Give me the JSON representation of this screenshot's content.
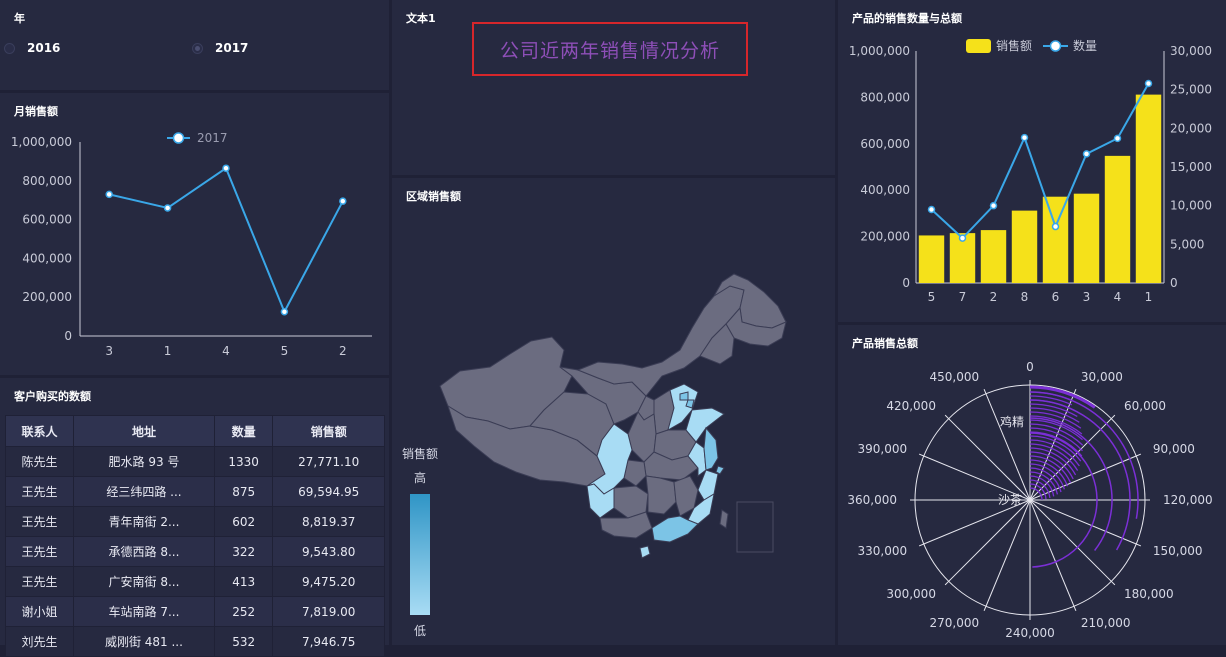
{
  "year_panel": {
    "title": "年",
    "options": [
      "2016",
      "2017"
    ],
    "selected": "2017"
  },
  "monthly_panel": {
    "title": "月销售额"
  },
  "customers_panel": {
    "title": "客户购买的数额",
    "columns": [
      "联系人",
      "地址",
      "数量",
      "销售额"
    ],
    "rows": [
      [
        "陈先生",
        "肥水路 93 号",
        "1330",
        "27,771.10"
      ],
      [
        "王先生",
        "经三纬四路 ...",
        "875",
        "69,594.95"
      ],
      [
        "王先生",
        "青年南街 2...",
        "602",
        "8,819.37"
      ],
      [
        "王先生",
        "承德西路 8...",
        "322",
        "9,543.80"
      ],
      [
        "王先生",
        "广安南街 8...",
        "413",
        "9,475.20"
      ],
      [
        "谢小姐",
        "车站南路 7...",
        "252",
        "7,819.00"
      ],
      [
        "刘先生",
        "威刚街 481 ...",
        "532",
        "7,946.75"
      ]
    ]
  },
  "text_panel": {
    "title": "文本1",
    "headline": "公司近两年销售情况分析"
  },
  "map_panel": {
    "title": "区域销售额",
    "legend_title": "销售额",
    "legend_high": "高",
    "legend_low": "低",
    "colors": {
      "high": "#2f95c6",
      "low": "#a8dcf4",
      "none": "#6b6c80"
    }
  },
  "combo_panel": {
    "title": "产品的销售数量与总额"
  },
  "polar_panel": {
    "title": "产品销售总额"
  },
  "chart_data": [
    {
      "type": "line",
      "categories": [
        "3",
        "1",
        "4",
        "5",
        "2"
      ],
      "series": [
        {
          "name": "2017",
          "values": [
            730000,
            660000,
            865000,
            125000,
            695000
          ]
        }
      ],
      "ylim": [
        0,
        1000000
      ],
      "yticks": [
        "0",
        "200,000",
        "400,000",
        "600,000",
        "800,000",
        "1,000,000"
      ],
      "legend": "top-center",
      "colors": {
        "line": "#3aa7e8"
      }
    },
    {
      "type": "bar",
      "categories": [
        "5",
        "7",
        "2",
        "8",
        "6",
        "3",
        "4",
        "1"
      ],
      "series": [
        {
          "name": "销售额",
          "type": "bar",
          "axis": "left",
          "values": [
            205000,
            215000,
            228000,
            312000,
            372000,
            385000,
            548000,
            812000
          ]
        },
        {
          "name": "数量",
          "type": "line",
          "axis": "right",
          "values": [
            9500,
            5800,
            10000,
            18800,
            7300,
            16700,
            18700,
            25800
          ]
        }
      ],
      "ylim_left": [
        0,
        1000000
      ],
      "ylim_right": [
        0,
        30000
      ],
      "yticks_left": [
        "0",
        "200,000",
        "400,000",
        "600,000",
        "800,000",
        "1,000,000"
      ],
      "yticks_right": [
        "0",
        "5,000",
        "10,000",
        "15,000",
        "20,000",
        "25,000",
        "30,000"
      ],
      "legend": "top-center",
      "colors": {
        "bar": "#f5e11a",
        "line": "#3aa7e8"
      }
    },
    {
      "type": "polar-bar",
      "angle_ticks": [
        "0",
        "30,000",
        "60,000",
        "90,000",
        "120,000",
        "150,000",
        "180,000",
        "210,000",
        "240,000",
        "270,000",
        "300,000",
        "330,000",
        "360,000",
        "390,000",
        "420,000",
        "450,000"
      ],
      "angle_max": 480000,
      "categories_labels": [
        "鸡精",
        "沙茶"
      ],
      "colors": {
        "bar": "#7b2fd6"
      }
    }
  ]
}
